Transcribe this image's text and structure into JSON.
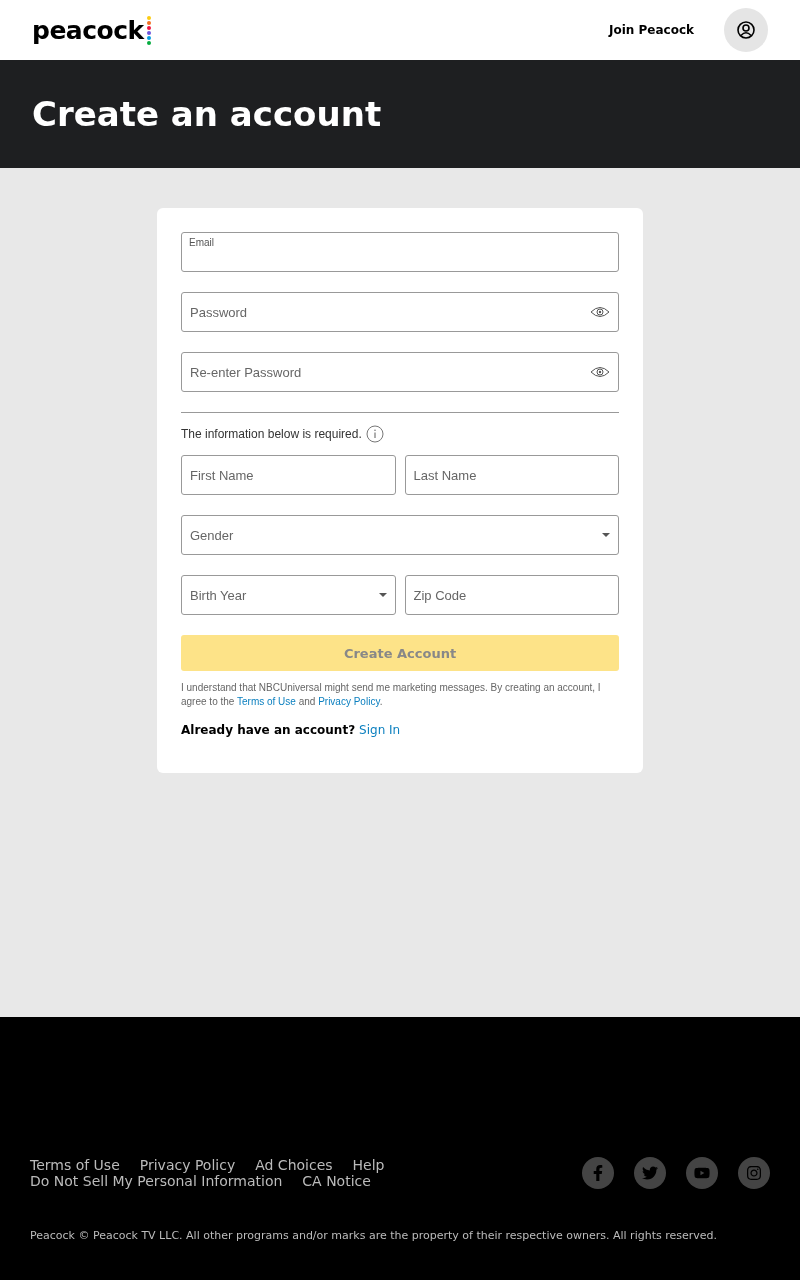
{
  "header": {
    "logo": "peacock",
    "join_link": "Join Peacock"
  },
  "title": "Create an account",
  "form": {
    "top_rows": [
      [
        {
          "kind": "floating",
          "label": "Email"
        }
      ],
      [
        {
          "kind": "password",
          "placeholder": "Password"
        }
      ],
      [
        {
          "kind": "password",
          "placeholder": "Re-enter Password"
        }
      ]
    ],
    "required_note": "The information below is required.",
    "bottom_rows": [
      [
        {
          "kind": "text",
          "placeholder": "First Name"
        },
        {
          "kind": "text",
          "placeholder": "Last Name"
        }
      ],
      [
        {
          "kind": "select",
          "placeholder": "Gender"
        }
      ],
      [
        {
          "kind": "select",
          "placeholder": "Birth Year"
        },
        {
          "kind": "text",
          "placeholder": "Zip Code"
        }
      ]
    ],
    "submit": {
      "label": "Create Account",
      "disabled": true
    },
    "consent": {
      "before": "I understand that NBCUniversal might send me marketing messages. By creating an account, I agree to the ",
      "terms_link": "Terms of Use",
      "middle": " and ",
      "privacy_link": "Privacy Policy",
      "after": "."
    },
    "signin": {
      "question": "Already have an account?",
      "link": "Sign In"
    }
  },
  "footer": {
    "link_rows": [
      [
        "Terms of Use",
        "Privacy Policy",
        "Ad Choices",
        "Help"
      ],
      [
        "Do Not Sell My Personal Information",
        "CA Notice"
      ]
    ],
    "social": [
      {
        "kind": "facebook"
      },
      {
        "kind": "twitter"
      },
      {
        "kind": "youtube"
      },
      {
        "kind": "instagram"
      }
    ],
    "copyright": "Peacock © Peacock TV LLC. All other programs and/or marks are the property of their respective owners. All rights reserved."
  }
}
